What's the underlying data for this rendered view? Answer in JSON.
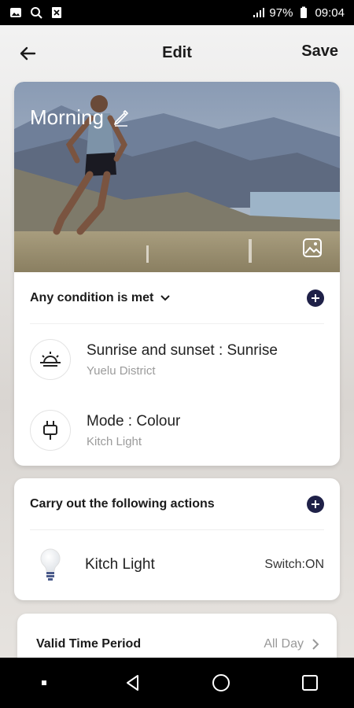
{
  "status_bar": {
    "battery": "97%",
    "time": "09:04"
  },
  "header": {
    "title": "Edit",
    "save_label": "Save"
  },
  "scene": {
    "name": "Morning"
  },
  "conditions": {
    "title": "Any condition is met",
    "items": [
      {
        "icon": "sunrise-icon",
        "label": "Sunrise and sunset : Sunrise",
        "sub": "Yuelu District"
      },
      {
        "icon": "plug-icon",
        "label": "Mode : Colour",
        "sub": "Kitch Light"
      }
    ]
  },
  "actions": {
    "title": "Carry out the following actions",
    "items": [
      {
        "icon": "bulb-icon",
        "label": "Kitch Light",
        "value": "Switch:ON"
      }
    ]
  },
  "valid_period": {
    "label": "Valid Time Period",
    "value": "All Day"
  },
  "colors": {
    "accent": "#1f2148",
    "text": "#1b1b1b",
    "muted": "#9b9b9b"
  }
}
